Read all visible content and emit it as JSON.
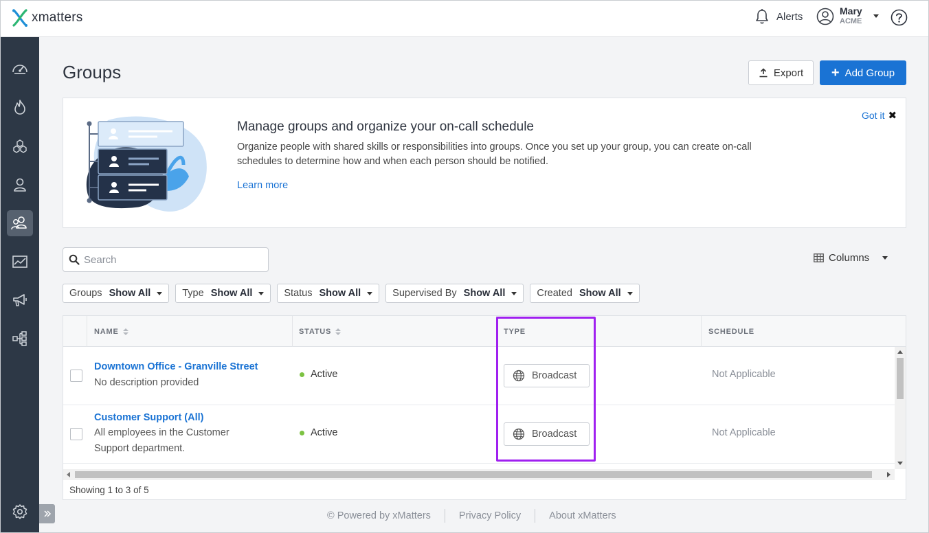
{
  "app": {
    "logo_text": "xmatters"
  },
  "topbar": {
    "alerts_label": "Alerts",
    "user_name": "Mary",
    "user_org": "ACME"
  },
  "sidebar": {
    "items": [
      {
        "name": "dashboard",
        "icon": "speedometer-icon",
        "active": false
      },
      {
        "name": "incidents",
        "icon": "flame-icon",
        "active": false
      },
      {
        "name": "workflows",
        "icon": "hexagons-icon",
        "active": false
      },
      {
        "name": "users",
        "icon": "person-icon",
        "active": false
      },
      {
        "name": "groups",
        "icon": "people-group-icon",
        "active": true
      },
      {
        "name": "analytics",
        "icon": "chart-icon",
        "active": false
      },
      {
        "name": "messaging",
        "icon": "megaphone-icon",
        "active": false
      },
      {
        "name": "integrations",
        "icon": "flow-diagram-icon",
        "active": false
      }
    ],
    "settings_icon": "gear-icon"
  },
  "page": {
    "title": "Groups",
    "export_label": "Export",
    "add_group_label": "Add Group"
  },
  "banner": {
    "title": "Manage groups and organize your on-call schedule",
    "description": "Organize people with shared skills or responsibilities into groups. Once you set up your group, you can create on-call schedules to determine how and when each person should be notified.",
    "learn_more": "Learn more",
    "got_it": "Got it"
  },
  "search": {
    "placeholder": "Search"
  },
  "columns_label": "Columns",
  "filters": [
    {
      "label": "Groups",
      "value": "Show All"
    },
    {
      "label": "Type",
      "value": "Show All"
    },
    {
      "label": "Status",
      "value": "Show All"
    },
    {
      "label": "Supervised By",
      "value": "Show All"
    },
    {
      "label": "Created",
      "value": "Show All"
    }
  ],
  "table": {
    "columns": [
      "NAME",
      "STATUS",
      "TYPE",
      "SCHEDULE"
    ],
    "rows": [
      {
        "name": "Downtown Office - Granville Street",
        "description": "No description provided",
        "status": "Active",
        "type": "Broadcast",
        "schedule": "Not Applicable"
      },
      {
        "name": "Customer Support (All)",
        "description_line1": "All employees in the Customer",
        "description_line2": "Support department.",
        "status": "Active",
        "type": "Broadcast",
        "schedule": "Not Applicable"
      }
    ],
    "showing": "Showing 1 to 3 of 5"
  },
  "footer": {
    "powered_by": "© Powered by xMatters",
    "privacy": "Privacy Policy",
    "about": "About xMatters"
  },
  "colors": {
    "primary": "#1a73d4",
    "sidebar": "#2d3846",
    "active_status": "#7cc242",
    "highlight": "#a020f0"
  }
}
